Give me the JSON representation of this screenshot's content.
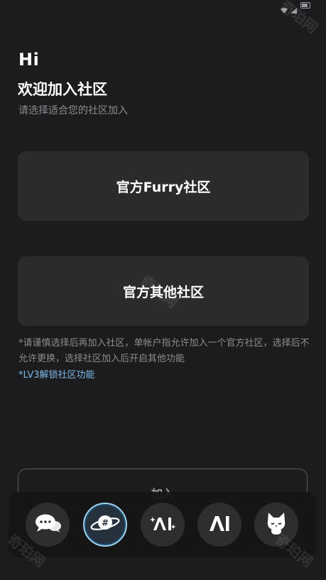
{
  "status_bar": {
    "time": ""
  },
  "header": {
    "greeting": "Hi",
    "welcome": "欢迎加入社区",
    "subtitle": "请选择适合您的社区加入"
  },
  "options": [
    {
      "label": "官方Furry社区"
    },
    {
      "label": "官方其他社区"
    }
  ],
  "notice": {
    "text": "*请谨慎选择后再加入社区，单帐户指允许加入一个官方社区，选择后不允许更换，选择社区加入后开启其他功能",
    "unlock": "*LV3解锁社区功能"
  },
  "join_button": {
    "label": "加入"
  },
  "dock": {
    "items": [
      {
        "icon": "chat-bubbles-icon",
        "active": false
      },
      {
        "icon": "planet-hashtag-icon",
        "active": true
      },
      {
        "icon": "ai-sparkle-icon",
        "active": false
      },
      {
        "icon": "ai-logo-icon",
        "active": false
      },
      {
        "icon": "cat-face-icon",
        "active": false
      }
    ]
  },
  "watermark": {
    "text": "奇珀网"
  },
  "colors": {
    "background": "#1c1c1e",
    "card": "#2b2b2e",
    "muted_text": "#8c8c90",
    "link": "#7db8e8",
    "active_ring": "#9fd2ef"
  }
}
